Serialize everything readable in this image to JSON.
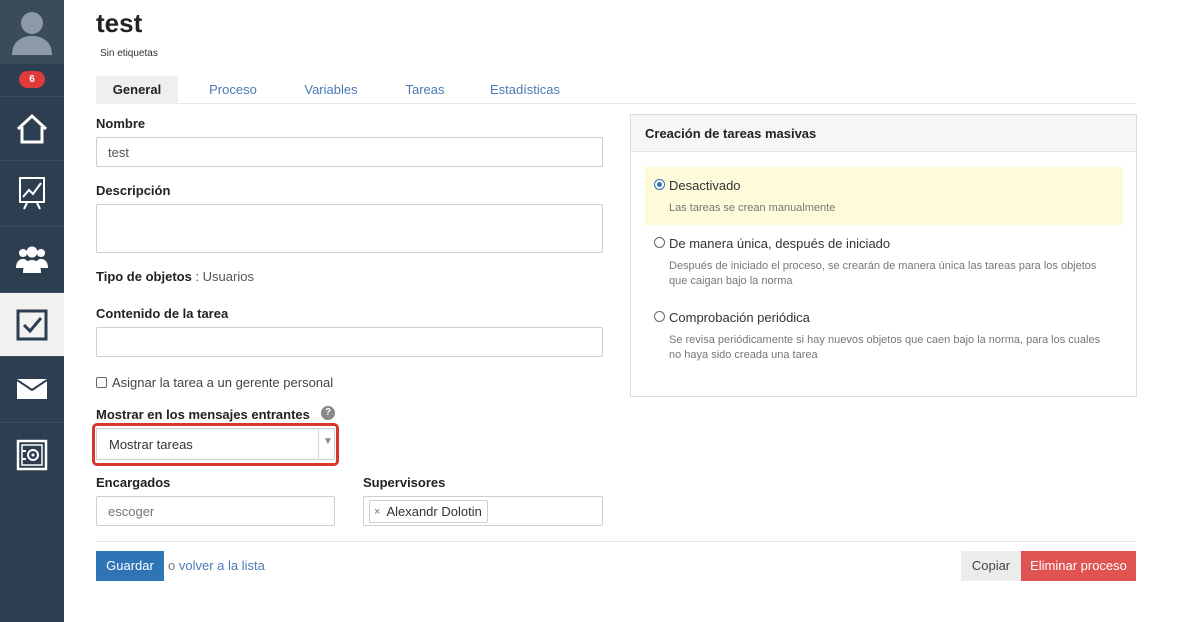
{
  "sidebar": {
    "notification_count": "6",
    "items": [
      {
        "icon": "home-icon"
      },
      {
        "icon": "chart-icon"
      },
      {
        "icon": "users-icon"
      },
      {
        "icon": "tasks-checkbox-icon",
        "active": true
      },
      {
        "icon": "mail-icon"
      },
      {
        "icon": "safe-settings-icon"
      }
    ]
  },
  "page": {
    "title": "test",
    "tags": "Sin etiquetas"
  },
  "tabs": [
    "General",
    "Proceso",
    "Variables",
    "Tareas",
    "Estadísticas"
  ],
  "form": {
    "name_label": "Nombre",
    "name_value": "test",
    "description_label": "Descripción",
    "description_value": "",
    "object_type_label": "Tipo de objetos",
    "object_type_value": " : Usuarios",
    "task_content_label": "Contenido de la tarea",
    "task_content_value": "",
    "assign_manager_label": "Asignar la tarea a un gerente personal",
    "assign_manager_checked": false,
    "show_in_messages_label": "Mostrar en los mensajes entrantes",
    "help_symbol": "?",
    "show_in_messages_value": "Mostrar tareas",
    "dropdown_arrow": "▼",
    "assignees_label": "Encargados",
    "assignees_placeholder": "escoger",
    "supervisors_label": "Supervisores",
    "supervisors": [
      {
        "name": "Alexandr Dolotin",
        "remove": "×"
      }
    ]
  },
  "actions": {
    "save": "Guardar",
    "or_text": "o",
    "back_link": "volver a la lista",
    "copy": "Copiar",
    "delete": "Eliminar proceso"
  },
  "mass_tasks": {
    "title": "Creación de tareas masivas",
    "options": [
      {
        "title": "Desactivado",
        "description": "Las tareas se crean manualmente",
        "selected": true
      },
      {
        "title": "De manera única, después de iniciado",
        "description": "Después de iniciado el proceso, se crearán de manera única las tareas para los objetos que caigan bajo la norma",
        "selected": false
      },
      {
        "title": "Comprobación periódica",
        "description": "Se revisa periódicamente si hay nuevos objetos que caen bajo la norma, para los cuales no haya sido creada una tarea",
        "selected": false
      }
    ]
  },
  "colors": {
    "sidebar_bg": "#2c3e50",
    "accent_blue": "#2f74b5",
    "delete_red": "#e05350",
    "highlight_red": "#d9362b",
    "selected_option_bg": "#fdfbd9"
  }
}
